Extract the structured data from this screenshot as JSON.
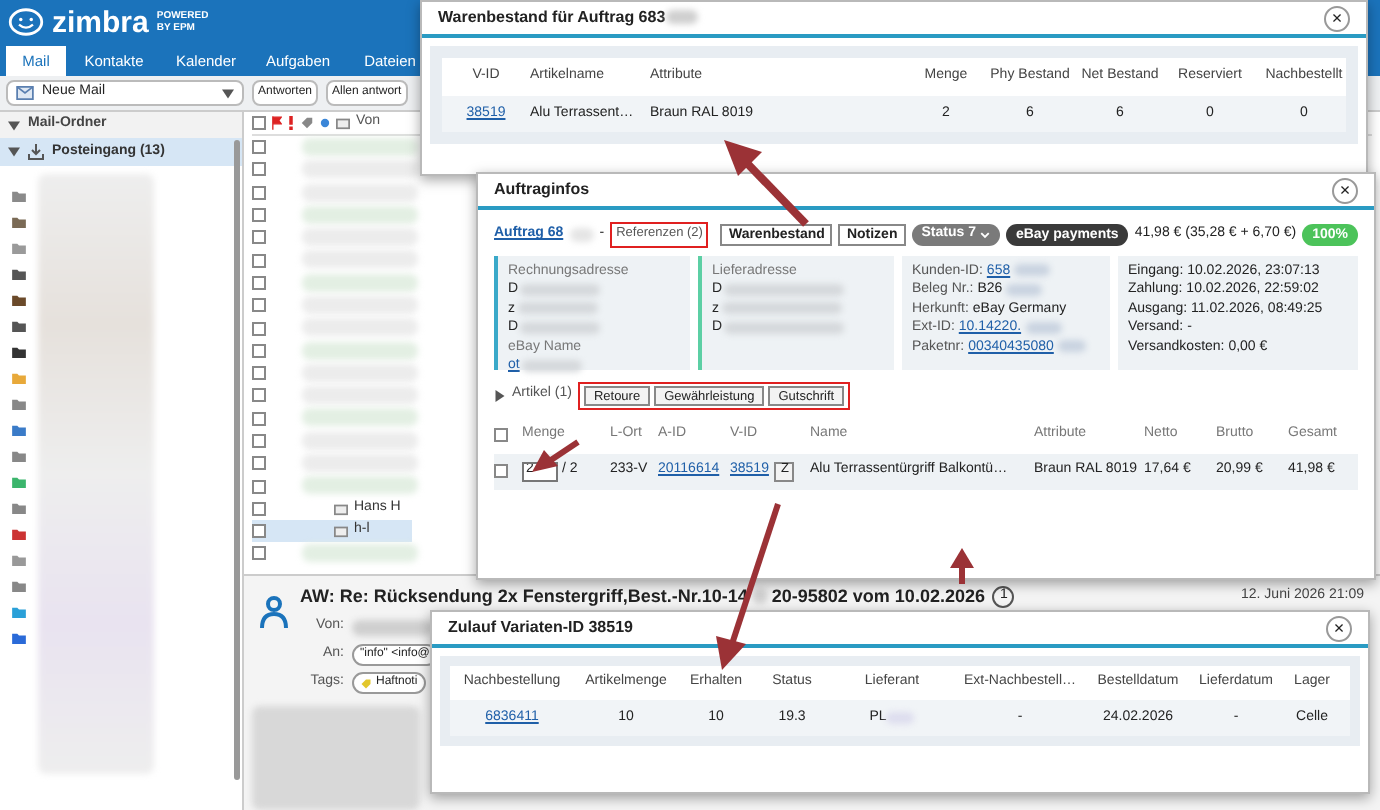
{
  "app": {
    "logo": "zimbra",
    "logo_sub": "POWERED BY EPM",
    "tabs": [
      {
        "label": "Mail",
        "selected": true
      },
      {
        "label": "Kontakte",
        "selected": false
      },
      {
        "label": "Kalender",
        "selected": false
      },
      {
        "label": "Aufgaben",
        "selected": false
      },
      {
        "label": "Dateien",
        "selected": false
      }
    ],
    "toolbar": {
      "new_mail": "Neue Mail",
      "buttons": [
        "Antworten",
        "Allen antwort"
      ]
    },
    "folders": {
      "header": "Mail-Ordner",
      "items": [
        {
          "label": "Posteingang (13)",
          "selected": true
        }
      ]
    },
    "message_list": {
      "header": "Von",
      "select_all_checked": false,
      "rows": [
        {
          "checked": false,
          "selected": false
        },
        {
          "checked": false,
          "selected": false
        },
        {
          "checked": false,
          "selected": false
        },
        {
          "checked": false,
          "selected": false
        },
        {
          "checked": false,
          "selected": false
        },
        {
          "checked": false,
          "selected": false
        },
        {
          "checked": false,
          "selected": false
        },
        {
          "checked": false,
          "selected": false
        },
        {
          "checked": false,
          "selected": false
        },
        {
          "checked": false,
          "selected": false
        },
        {
          "checked": false,
          "selected": false
        },
        {
          "checked": false,
          "selected": false
        },
        {
          "checked": false,
          "selected": false
        },
        {
          "checked": false,
          "selected": false
        },
        {
          "checked": false,
          "selected": false
        },
        {
          "checked": false,
          "selected": false
        },
        {
          "sender": "Hans H",
          "checked": false,
          "selected": false
        },
        {
          "sender": "h-l",
          "checked": false,
          "selected": true
        },
        {
          "checked": false,
          "selected": false
        }
      ]
    },
    "reading_pane": {
      "subject_start": "AW: Re: Rücksendung 2x Fenstergriff,Best.-Nr.10-14",
      "subject_end": "20-95802 vom 10.02.2026",
      "count": "1",
      "date": "12. Juni 2026 21:09",
      "from_label": "Von:",
      "to_label": "An:",
      "to": "\"info\" <info@",
      "tags_label": "Tags:",
      "tag": "Haftnoti"
    }
  },
  "stock_dialog": {
    "title": "Warenbestand für Auftrag 683",
    "close": "×",
    "columns": [
      "V-ID",
      "Artikelname",
      "Attribute",
      "Menge",
      "Phy Bestand",
      "Net Bestand",
      "Reserviert",
      "Nachbestellt"
    ],
    "rows": [
      [
        "38519",
        "Alu Terrassent…",
        "Braun RAL 8019",
        "2",
        "6",
        "6",
        "0",
        "0"
      ]
    ]
  },
  "order_dialog": {
    "title": "Auftraginfos",
    "close": "×",
    "order_link": "Auftrag 68",
    "dash": "-",
    "references": "Referenzen (2)",
    "buttons": [
      "Warenbestand",
      "Notizen"
    ],
    "status": "Status 7",
    "payment": "eBay payments",
    "amount": "41,98 € (35,28 € + 6,70 €)",
    "progress": "100%",
    "billing": {
      "heading": "Rechnungsadresse",
      "lines": [
        "D",
        "z",
        "D"
      ],
      "ebay_label": "eBay Name",
      "ebay_name": "ot"
    },
    "shipping": {
      "heading": "Lieferadresse",
      "lines": [
        "D",
        "z",
        "D"
      ]
    },
    "customer": [
      {
        "label": "Kunden-ID:",
        "value": "658",
        "link": true
      },
      {
        "label": "Beleg Nr.:",
        "value": "B26",
        "link": false
      },
      {
        "label": "Herkunft:",
        "value": "eBay Germany",
        "link": false
      },
      {
        "label": "Ext-ID:",
        "value": "10.14220.",
        "link": true
      },
      {
        "label": "Paketnr:",
        "value": "00340435080",
        "link": true
      }
    ],
    "dates": [
      "Eingang: 10.02.2026, 23:07:13",
      "Zahlung: 10.02.2026, 22:59:02",
      "Ausgang: 11.02.2026, 08:49:25",
      "Versand: -",
      "Versandkosten: 0,00 €"
    ],
    "articles_label": "Artikel (1)",
    "select_all_checked": false,
    "article_actions": [
      "Retoure",
      "Gewährleistung",
      "Gutschrift"
    ],
    "columns": [
      "Menge",
      "L-Ort",
      "A-ID",
      "V-ID",
      "Name",
      "Attribute",
      "Netto",
      "Brutto",
      "Gesamt"
    ],
    "rows": [
      {
        "checked": false,
        "quantity": "2",
        "of": "/ 2",
        "location": "233-V",
        "article_id": "20116614",
        "variant_id": "38519",
        "z": "Z",
        "name": "Alu Terrassentürgriff Balkontü…",
        "attribute": "Braun RAL 8019",
        "net": "17,64 €",
        "gross": "20,99 €",
        "total": "41,98 €"
      }
    ]
  },
  "inflow_dialog": {
    "title": "Zulauf Variaten-ID 38519",
    "close": "×",
    "columns": [
      "Nachbestellung",
      "Artikelmenge",
      "Erhalten",
      "Status",
      "Lieferant",
      "Ext-Nachbestell…",
      "Bestelldatum",
      "Lieferdatum",
      "Lager"
    ],
    "rows": [
      [
        "6836411",
        "10",
        "10",
        "19.3",
        "PL",
        "-",
        "24.02.2026",
        "-",
        "Celle"
      ]
    ]
  }
}
